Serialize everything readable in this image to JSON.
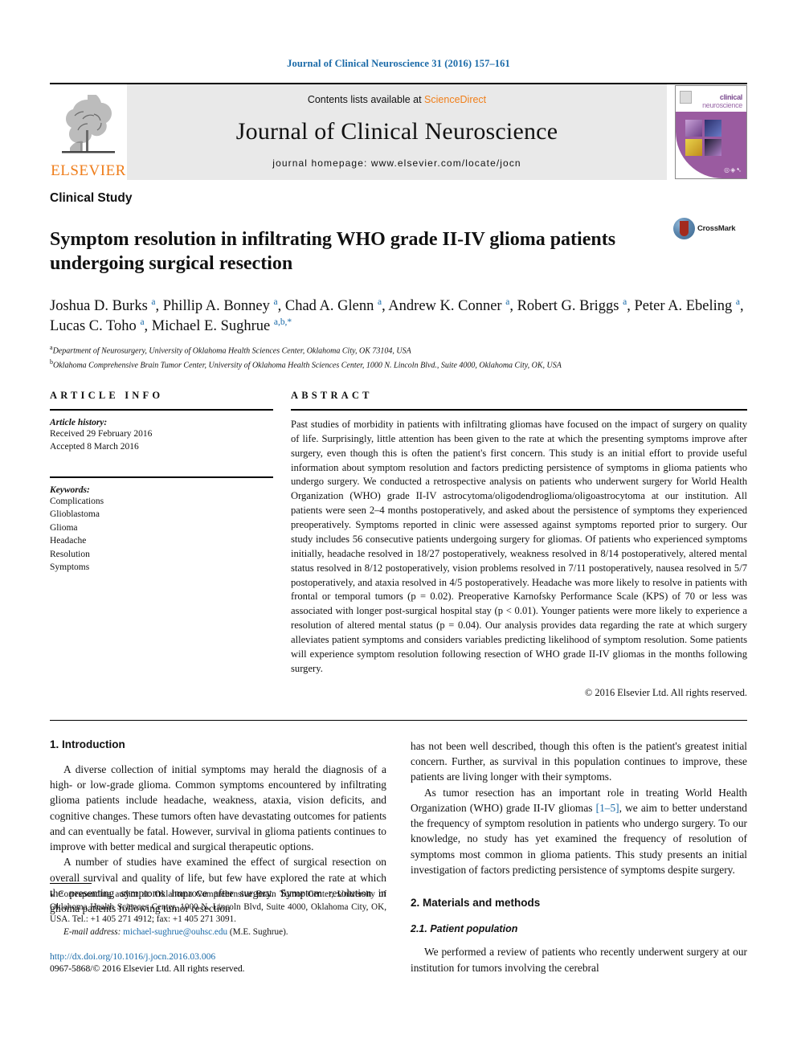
{
  "running_head": "Journal of Clinical Neuroscience 31 (2016) 157–161",
  "masthead": {
    "contents_prefix": "Contents lists available at ",
    "sciencedirect": "ScienceDirect",
    "journal_title": "Journal of Clinical Neuroscience",
    "homepage": "journal homepage: www.elsevier.com/locate/jocn",
    "publisher": "ELSEVIER",
    "cover": {
      "brand_line1": "clinical",
      "brand_line2": "neuroscience",
      "dots": "◎◈➷"
    }
  },
  "section_type": "Clinical Study",
  "title": "Symptom resolution in infiltrating WHO grade II-IV glioma patients undergoing surgical resection",
  "crossmark_label": "CrossMark",
  "authors_html": "Joshua D. Burks <sup>a</sup>, Phillip A. Bonney <sup>a</sup>, Chad A. Glenn <sup>a</sup>, Andrew K. Conner <sup>a</sup>, Robert G. Briggs <sup>a</sup>, Peter A. Ebeling <sup>a</sup>, Lucas C. Toho <sup>a</sup>, Michael E. Sughrue <sup>a,b,</sup><sup>*</sup>",
  "affiliations": [
    {
      "mark": "a",
      "text": "Department of Neurosurgery, University of Oklahoma Health Sciences Center, Oklahoma City, OK 73104, USA"
    },
    {
      "mark": "b",
      "text": "Oklahoma Comprehensive Brain Tumor Center, University of Oklahoma Health Sciences Center, 1000 N. Lincoln Blvd., Suite 4000, Oklahoma City, OK, USA"
    }
  ],
  "article_info": {
    "heading": "ARTICLE INFO",
    "history_label": "Article history:",
    "history_lines": [
      "Received 29 February 2016",
      "Accepted 8 March 2016"
    ],
    "keywords_label": "Keywords:",
    "keywords": [
      "Complications",
      "Glioblastoma",
      "Glioma",
      "Headache",
      "Resolution",
      "Symptoms"
    ]
  },
  "abstract": {
    "heading": "ABSTRACT",
    "text": "Past studies of morbidity in patients with infiltrating gliomas have focused on the impact of surgery on quality of life. Surprisingly, little attention has been given to the rate at which the presenting symptoms improve after surgery, even though this is often the patient's first concern. This study is an initial effort to provide useful information about symptom resolution and factors predicting persistence of symptoms in glioma patients who undergo surgery. We conducted a retrospective analysis on patients who underwent surgery for World Health Organization (WHO) grade II-IV astrocytoma/oligodendroglioma/oligoastrocytoma at our institution. All patients were seen 2–4 months postoperatively, and asked about the persistence of symptoms they experienced preoperatively. Symptoms reported in clinic were assessed against symptoms reported prior to surgery. Our study includes 56 consecutive patients undergoing surgery for gliomas. Of patients who experienced symptoms initially, headache resolved in 18/27 postoperatively, weakness resolved in 8/14 postoperatively, altered mental status resolved in 8/12 postoperatively, vision problems resolved in 7/11 postoperatively, nausea resolved in 5/7 postoperatively, and ataxia resolved in 4/5 postoperatively. Headache was more likely to resolve in patients with frontal or temporal tumors (p = 0.02). Preoperative Karnofsky Performance Scale (KPS) of 70 or less was associated with longer post-surgical hospital stay (p < 0.01). Younger patients were more likely to experience a resolution of altered mental status (p = 0.04). Our analysis provides data regarding the rate at which surgery alleviates patient symptoms and considers variables predicting likelihood of symptom resolution. Some patients will experience symptom resolution following resection of WHO grade II-IV gliomas in the months following surgery.",
    "copyright": "© 2016 Elsevier Ltd. All rights reserved."
  },
  "body": {
    "intro_heading": "1. Introduction",
    "intro_para1": "A diverse collection of initial symptoms may herald the diagnosis of a high- or low-grade glioma. Common symptoms encountered by infiltrating glioma patients include headache, weakness, ataxia, vision deficits, and cognitive changes. These tumors often have devastating outcomes for patients and can eventually be fatal. However, survival in glioma patients continues to improve with better medical and surgical therapeutic options.",
    "intro_para2": "A number of studies have examined the effect of surgical resection on overall survival and quality of life, but few have explored the rate at which the presenting symptoms improve after surgery. Symptom resolution in glioma patients following tumor resection",
    "intro_para2_cont": "has not been well described, though this often is the patient's greatest initial concern. Further, as survival in this population continues to improve, these patients are living longer with their symptoms.",
    "intro_para3_pre": "As tumor resection has an important role in treating World Health Organization (WHO) grade II-IV gliomas ",
    "intro_para3_ref": "[1–5]",
    "intro_para3_post": ", we aim to better understand the frequency of symptom resolution in patients who undergo surgery. To our knowledge, no study has yet examined the frequency of resolution of symptoms most common in glioma patients. This study presents an initial investigation of factors predicting persistence of symptoms despite surgery.",
    "methods_heading": "2. Materials and methods",
    "methods_subheading": "2.1. Patient population",
    "methods_para1": "We performed a review of patients who recently underwent surgery at our institution for tumors involving the cerebral"
  },
  "footnote": {
    "marker": "⁎",
    "corresponding": " Corresponding author at: Oklahoma Comprehensive Brain Tumor Center, University of Oklahoma Health Sciences Center, 1000 N. Lincoln Blvd, Suite 4000, Oklahoma City, OK, USA. Tel.: +1 405 271 4912; fax: +1 405 271 3091.",
    "email_label": "E-mail address:",
    "email": "michael-sughrue@ouhsc.edu",
    "email_suffix": " (M.E. Sughrue).",
    "doi": "http://dx.doi.org/10.1016/j.jocn.2016.03.006",
    "issn_line": "0967-5868/© 2016 Elsevier Ltd. All rights reserved."
  }
}
